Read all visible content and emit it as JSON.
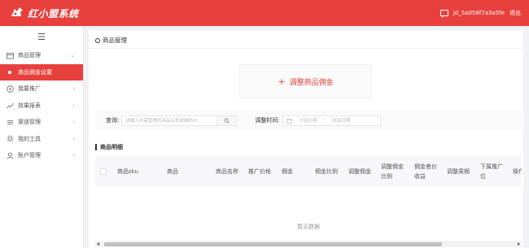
{
  "app": {
    "title": "红小盟系统",
    "brand_color": "#e8403d"
  },
  "header": {
    "message_icon": "message-icon",
    "user": "jd_5a058f7a3a5fe",
    "logout": "退出"
  },
  "sidebar": {
    "toggle_icon": "menu-icon",
    "items": [
      {
        "label": "商品管理",
        "icon": "shop-icon",
        "arrow": "v"
      },
      {
        "label": "商品佣金设置",
        "active": true
      },
      {
        "label": "我要推广",
        "icon": "promote-icon",
        "arrow": "<"
      },
      {
        "label": "效果报表",
        "icon": "chart-icon",
        "arrow": "<"
      },
      {
        "label": "渠道管理",
        "icon": "channel-icon",
        "arrow": "<"
      },
      {
        "label": "我的工具",
        "icon": "tool-icon",
        "arrow": "<"
      },
      {
        "label": "账户管理",
        "icon": "user-icon",
        "arrow": "<"
      }
    ]
  },
  "page": {
    "breadcrumb": "商品管理",
    "adjust_button": "调整商品佣金",
    "filters": {
      "query_label": "查询:",
      "search_placeholder": "请输入所需管理的商品名称或编码ID",
      "time_label": "调整时间:",
      "start_placeholder": "开始日期",
      "range_sep": "~",
      "end_placeholder": "结束日期"
    },
    "detail_title": "商品明细",
    "columns": [
      "商品sku",
      "商品",
      "商品名称",
      "推广价格",
      "佣金",
      "佣金比例",
      "调整佣金",
      "调整佣金比例",
      "佣金差价收益",
      "调整周期",
      "下属推广位",
      "操作"
    ],
    "empty_text": "暂无数据"
  }
}
